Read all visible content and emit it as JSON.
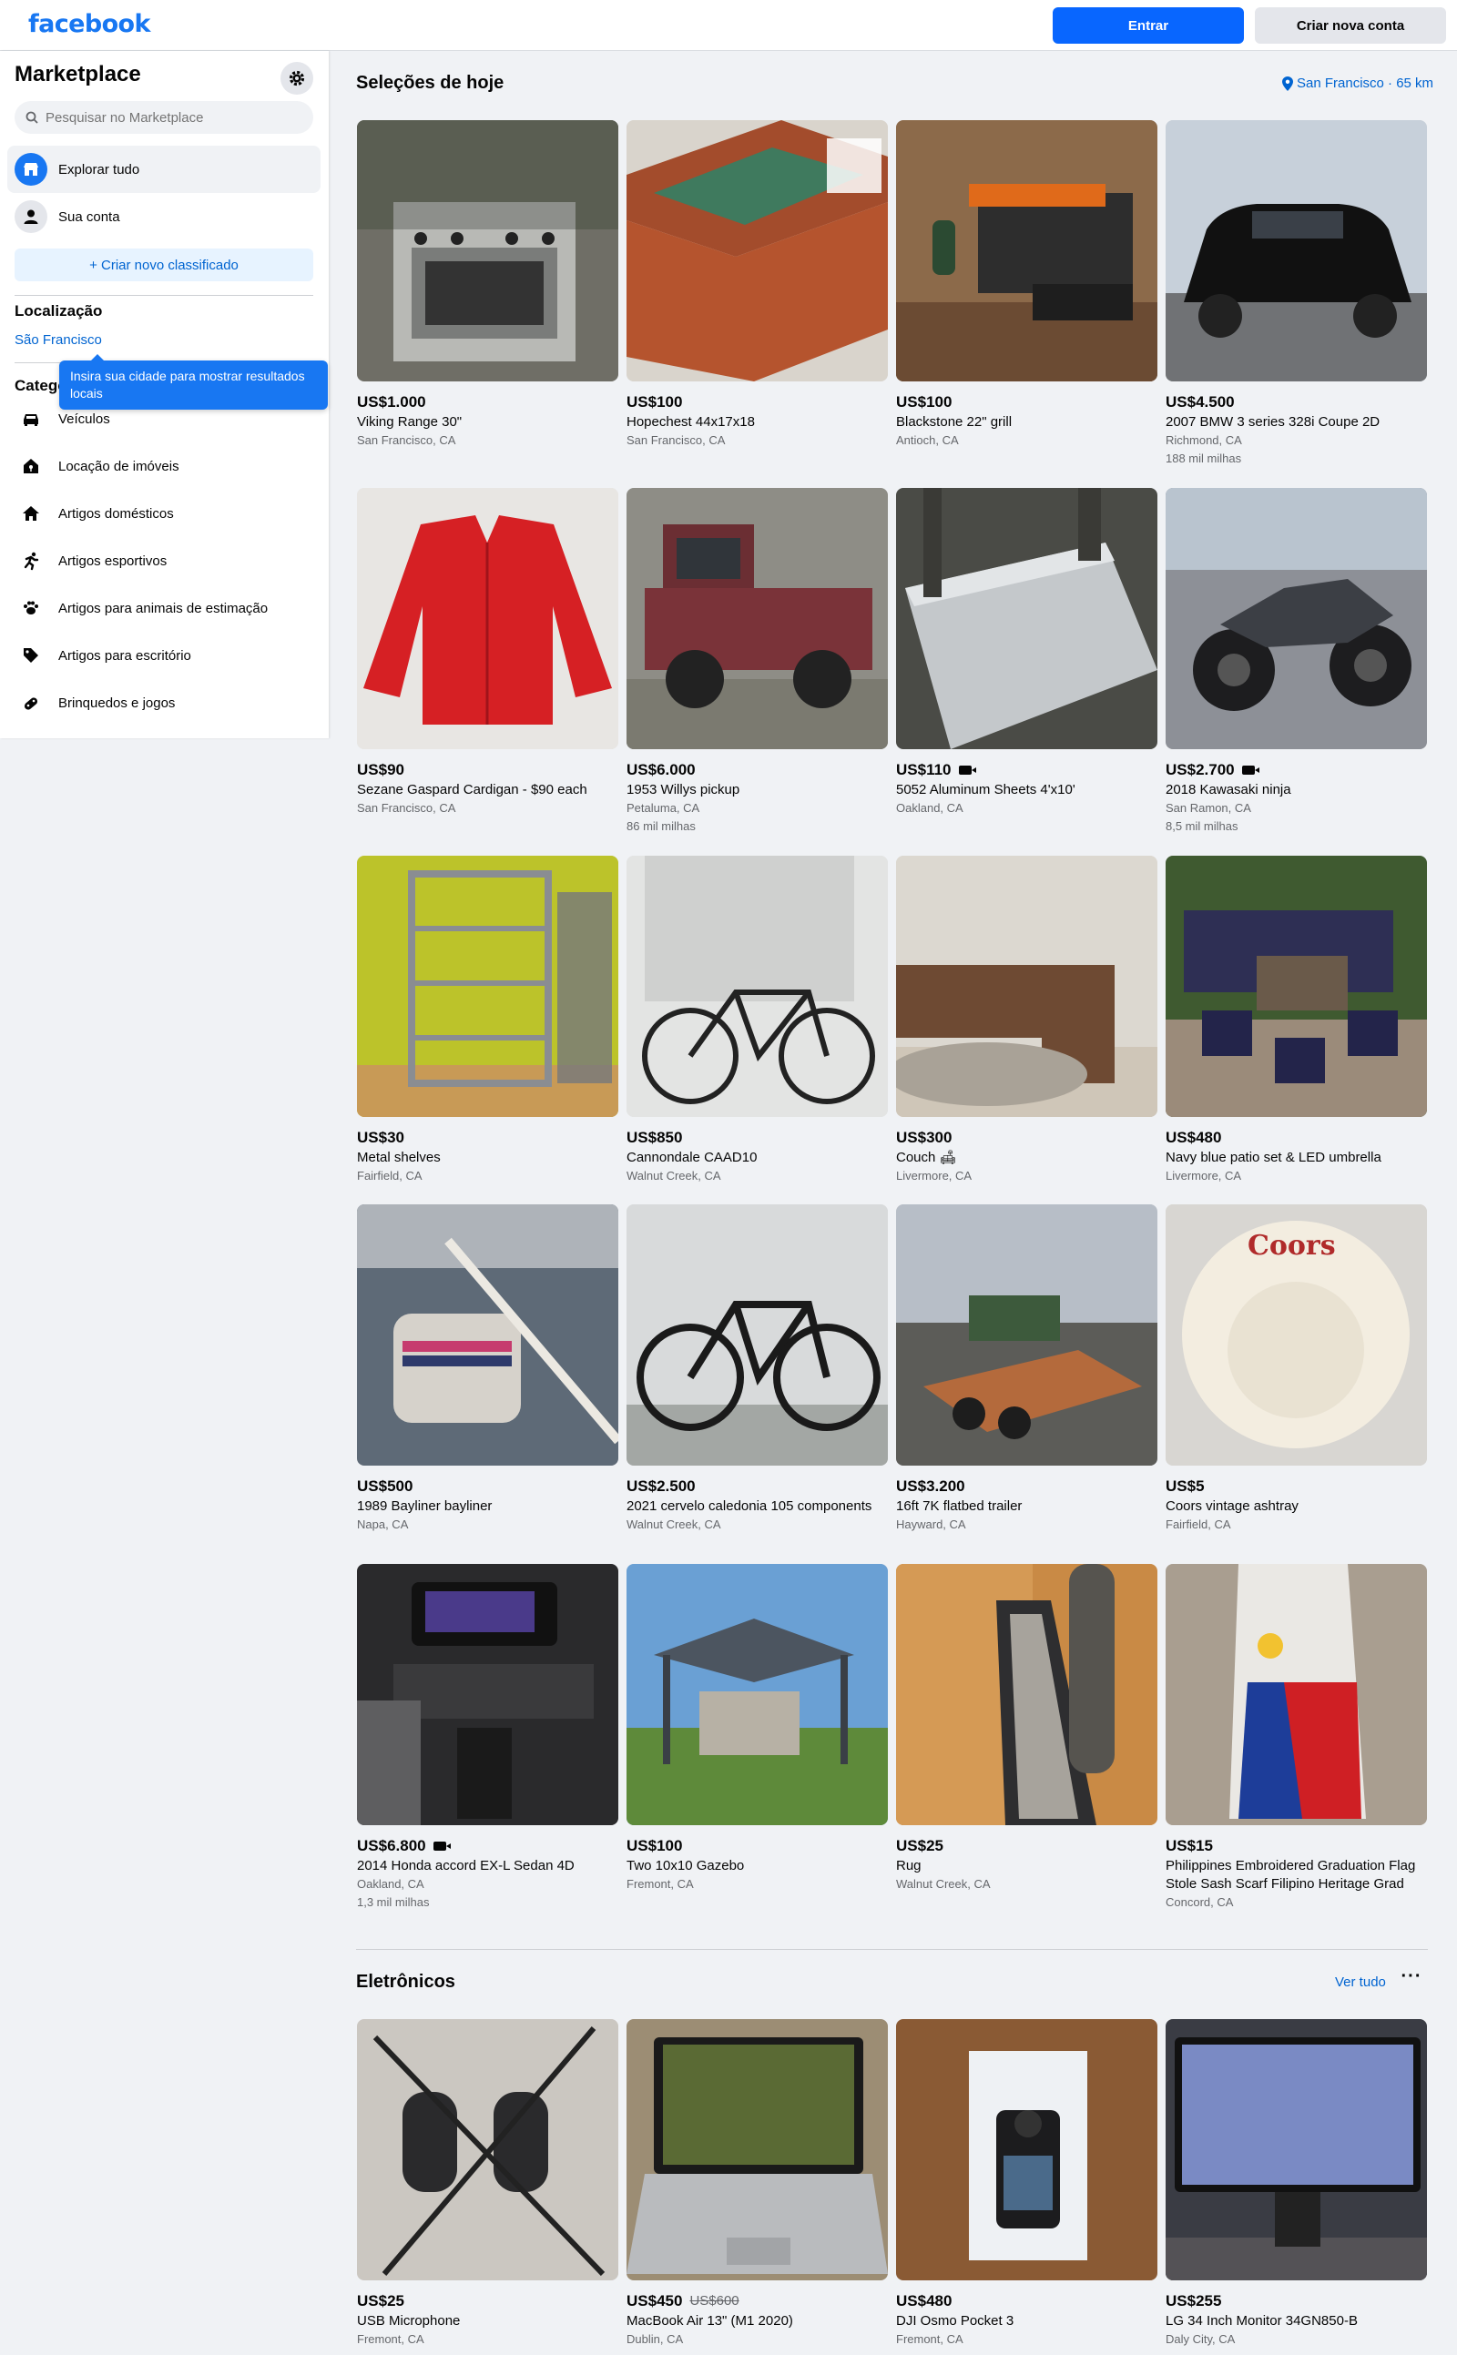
{
  "header": {
    "logo": "facebook",
    "login_label": "Entrar",
    "signup_label": "Criar nova conta"
  },
  "sidebar": {
    "title": "Marketplace",
    "search_placeholder": "Pesquisar no Marketplace",
    "nav": [
      {
        "label": "Explorar tudo",
        "icon": "storefront-icon"
      },
      {
        "label": "Sua conta",
        "icon": "person-icon"
      }
    ],
    "create_label": "+ Criar novo classificado",
    "location_title": "Localização",
    "location_value": "São Francisco",
    "tooltip": "Insira sua cidade para mostrar resultados locais",
    "categories_title": "Categorias",
    "categories": [
      {
        "label": "Veículos",
        "icon": "car-icon"
      },
      {
        "label": "Locação de imóveis",
        "icon": "house-key-icon"
      },
      {
        "label": "Artigos domésticos",
        "icon": "home-icon"
      },
      {
        "label": "Artigos esportivos",
        "icon": "running-icon"
      },
      {
        "label": "Artigos para animais de estimação",
        "icon": "paw-icon"
      },
      {
        "label": "Artigos para escritório",
        "icon": "tag-icon"
      },
      {
        "label": "Brinquedos e jogos",
        "icon": "toy-icon"
      }
    ]
  },
  "main": {
    "section1_title": "Seleções de hoje",
    "location_chip": "San Francisco · 65 km",
    "section2_title": "Eletrônicos",
    "see_all": "Ver tudo",
    "listings": [
      {
        "price": "US$1.000",
        "title": "Viking Range 30\"",
        "location": "San Francisco, CA",
        "extra": "",
        "video": false
      },
      {
        "price": "US$100",
        "title": "Hopechest 44x17x18",
        "location": "San Francisco, CA",
        "extra": "",
        "video": false
      },
      {
        "price": "US$100",
        "title": "Blackstone 22\" grill",
        "location": "Antioch, CA",
        "extra": "",
        "video": false
      },
      {
        "price": "US$4.500",
        "title": "2007 BMW 3 series 328i Coupe 2D",
        "location": "Richmond, CA",
        "extra": "188 mil milhas",
        "video": false
      },
      {
        "price": "US$90",
        "title": "Sezane Gaspard Cardigan - $90 each",
        "location": "San Francisco, CA",
        "extra": "",
        "video": false
      },
      {
        "price": "US$6.000",
        "title": "1953 Willys pickup",
        "location": "Petaluma, CA",
        "extra": "86 mil milhas",
        "video": false
      },
      {
        "price": "US$110",
        "title": "5052 Aluminum Sheets 4'x10'",
        "location": "Oakland, CA",
        "extra": "",
        "video": true
      },
      {
        "price": "US$2.700",
        "title": "2018 Kawasaki ninja",
        "location": "San Ramon, CA",
        "extra": "8,5 mil milhas",
        "video": true
      },
      {
        "price": "US$30",
        "title": "Metal shelves",
        "location": "Fairfield, CA",
        "extra": "",
        "video": false
      },
      {
        "price": "US$850",
        "title": "Cannondale CAAD10",
        "location": "Walnut Creek, CA",
        "extra": "",
        "video": false
      },
      {
        "price": "US$300",
        "title": "Couch 🛋",
        "location": "Livermore, CA",
        "extra": "",
        "video": false
      },
      {
        "price": "US$480",
        "title": "Navy blue patio set & LED umbrella",
        "location": "Livermore, CA",
        "extra": "",
        "video": false
      },
      {
        "price": "US$500",
        "title": "1989 Bayliner bayliner",
        "location": "Napa, CA",
        "extra": "",
        "video": false
      },
      {
        "price": "US$2.500",
        "title": "2021 cervelo caledonia 105 components",
        "location": "Walnut Creek, CA",
        "extra": "",
        "video": false
      },
      {
        "price": "US$3.200",
        "title": "16ft 7K flatbed trailer",
        "location": "Hayward, CA",
        "extra": "",
        "video": false
      },
      {
        "price": "US$5",
        "title": "Coors vintage ashtray",
        "location": "Fairfield, CA",
        "extra": "",
        "video": false
      },
      {
        "price": "US$6.800",
        "title": "2014 Honda accord EX-L Sedan 4D",
        "location": "Oakland, CA",
        "extra": "1,3 mil milhas",
        "video": true
      },
      {
        "price": "US$100",
        "title": "Two 10x10 Gazebo",
        "location": "Fremont, CA",
        "extra": "",
        "video": false
      },
      {
        "price": "US$25",
        "title": "Rug",
        "location": "Walnut Creek, CA",
        "extra": "",
        "video": false
      },
      {
        "price": "US$15",
        "title": "Philippines Embroidered Graduation Flag Stole Sash Scarf Filipino Heritage Grad",
        "location": "Concord, CA",
        "extra": "",
        "video": false
      }
    ],
    "electronics": [
      {
        "price": "US$25",
        "old_price": "",
        "title": "USB Microphone",
        "location": "Fremont, CA"
      },
      {
        "price": "US$450",
        "old_price": "US$600",
        "title": "MacBook Air 13\" (M1 2020)",
        "location": "Dublin, CA"
      },
      {
        "price": "US$480",
        "old_price": "",
        "title": "DJI Osmo Pocket 3",
        "location": "Fremont, CA"
      },
      {
        "price": "US$255",
        "old_price": "",
        "title": "LG 34 Inch Monitor 34GN850-B",
        "location": "Daly City, CA"
      }
    ]
  }
}
